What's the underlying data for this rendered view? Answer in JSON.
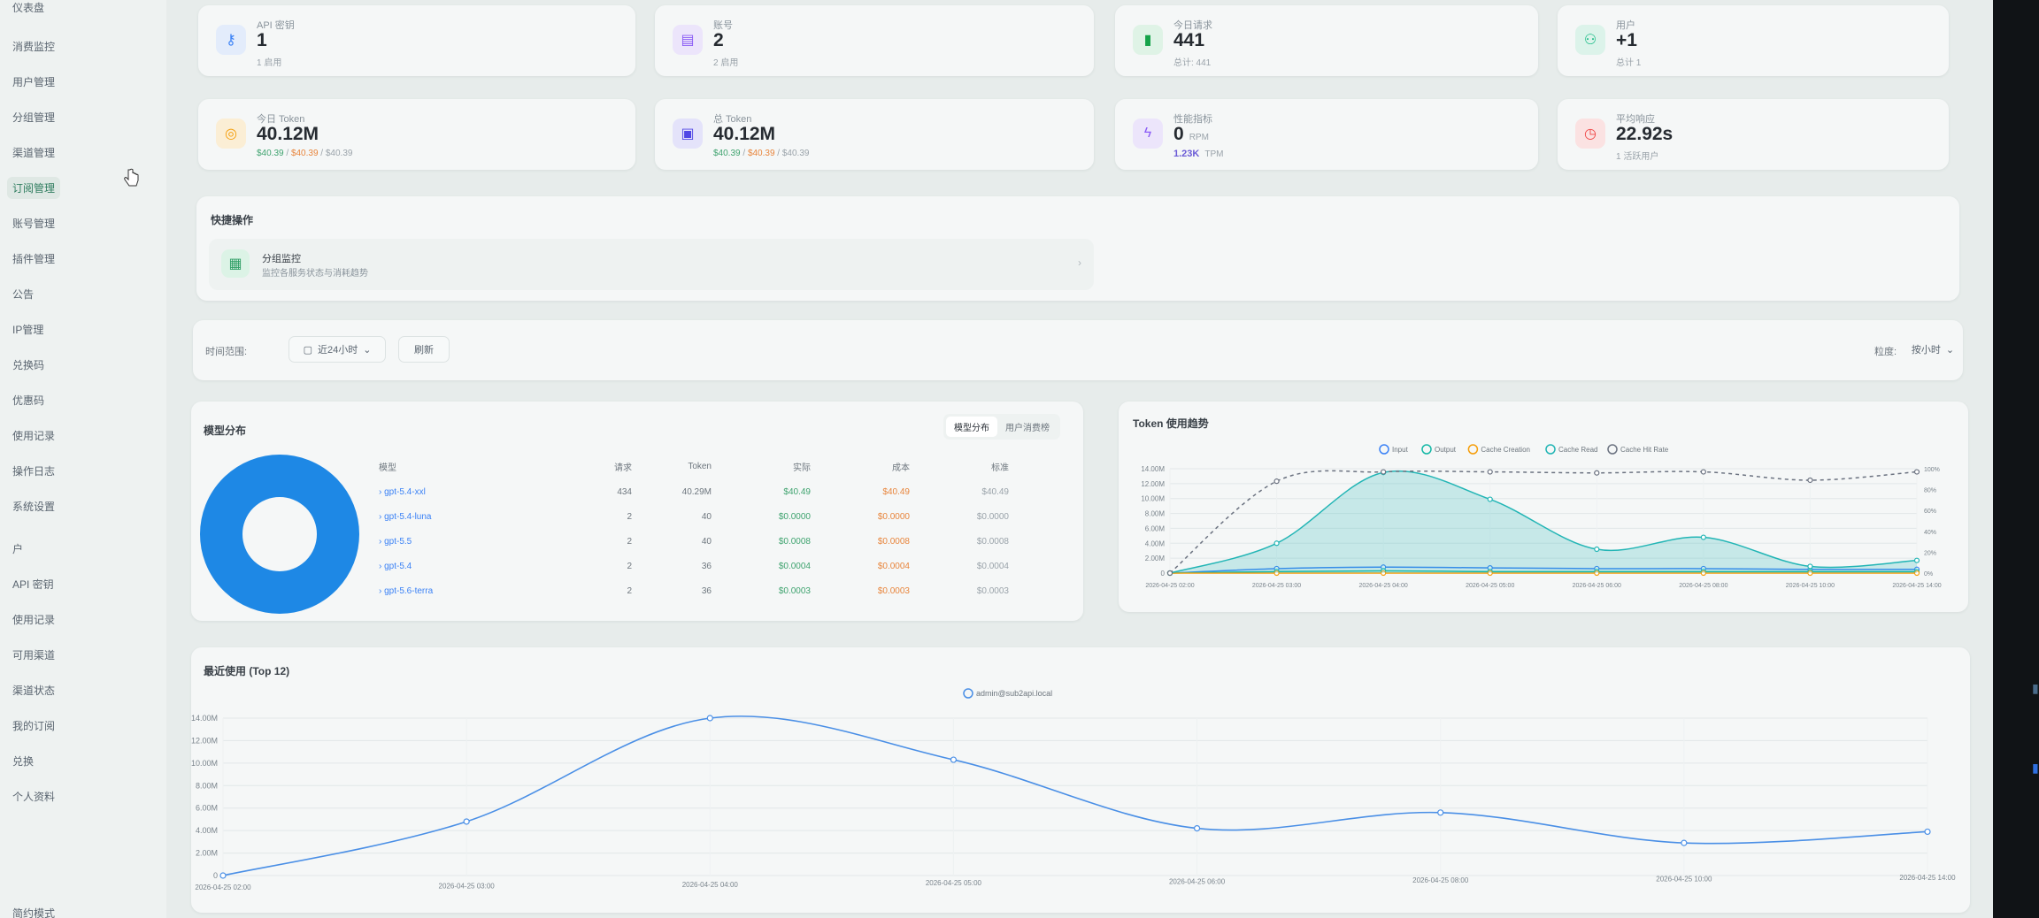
{
  "sidebar": {
    "items": [
      {
        "label": "仪表盘"
      },
      {
        "label": "消费监控"
      },
      {
        "label": "用户管理"
      },
      {
        "label": "分组管理"
      },
      {
        "label": "渠道管理"
      },
      {
        "label": "订阅管理"
      },
      {
        "label": "账号管理"
      },
      {
        "label": "插件管理"
      },
      {
        "label": "公告"
      },
      {
        "label": "IP管理"
      },
      {
        "label": "兑换码"
      },
      {
        "label": "优惠码"
      },
      {
        "label": "使用记录"
      },
      {
        "label": "操作日志"
      },
      {
        "label": "系统设置"
      },
      {
        "label": "户"
      },
      {
        "label": "API 密钥"
      },
      {
        "label": "使用记录"
      },
      {
        "label": "可用渠道"
      },
      {
        "label": "渠道状态"
      },
      {
        "label": "我的订阅"
      },
      {
        "label": "兑换"
      },
      {
        "label": "个人资料"
      },
      {
        "label": "简约模式"
      }
    ]
  },
  "stats_row1": [
    {
      "label": "API 密钥",
      "value": "1",
      "sub": "1 启用",
      "icon": "key-icon",
      "color": "#3b82f6",
      "bg": "#e3ecfb"
    },
    {
      "label": "账号",
      "value": "2",
      "sub": "2 启用",
      "icon": "server-icon",
      "color": "#8b5cf6",
      "bg": "#ece5fb"
    },
    {
      "label": "今日请求",
      "value": "441",
      "sub": "总计: 441",
      "icon": "bar-chart-icon",
      "color": "#16a34a",
      "bg": "#dff3e6"
    },
    {
      "label": "用户",
      "value": "+1",
      "sub": "总计 1",
      "icon": "users-icon",
      "color": "#10b981",
      "bg": "#dcf3ea"
    }
  ],
  "stats_row2": [
    {
      "label": "今日 Token",
      "value": "40.12M",
      "sub_parts": [
        "$40.39",
        " / ",
        "$40.39",
        " / ",
        "$40.39"
      ],
      "icon": "coin-icon",
      "color": "#f59e0b",
      "bg": "#fbeed5"
    },
    {
      "label": "总 Token",
      "value": "40.12M",
      "sub_parts": [
        "$40.39",
        " / ",
        "$40.39",
        " / ",
        "$40.39"
      ],
      "icon": "database-icon",
      "color": "#4f46e5",
      "bg": "#e4e3fa"
    },
    {
      "label": "性能指标",
      "value": "0",
      "value_unit": "RPM",
      "sub_strong": "1.23K",
      "sub_unit": "TPM",
      "icon": "bolt-icon",
      "color": "#8b5cf6",
      "bg": "#ece5fb"
    },
    {
      "label": "平均响应",
      "value": "22.92s",
      "sub": "1 活跃用户",
      "icon": "clock-icon",
      "color": "#ef4444",
      "bg": "#fbe2e2"
    }
  ],
  "quick_actions": {
    "title": "快捷操作",
    "item": {
      "title": "分组监控",
      "desc": "监控各服务状态与消耗趋势"
    }
  },
  "filters": {
    "time_label": "时间范围:",
    "time_value": "近24小时",
    "refresh": "刷新",
    "granularity_label": "粒度:",
    "granularity_value": "按小时"
  },
  "model_distribution": {
    "title": "模型分布",
    "tabs": [
      "模型分布",
      "用户消费榜"
    ],
    "headers": [
      "模型",
      "请求",
      "Token",
      "实际",
      "成本",
      "标准"
    ],
    "rows": [
      [
        "› gpt-5.4-xxl",
        "434",
        "40.29M",
        "$40.49",
        "$40.49",
        "$40.49"
      ],
      [
        "› gpt-5.4-luna",
        "2",
        "40",
        "$0.0000",
        "$0.0000",
        "$0.0000"
      ],
      [
        "› gpt-5.5",
        "2",
        "40",
        "$0.0008",
        "$0.0008",
        "$0.0008"
      ],
      [
        "› gpt-5.4",
        "2",
        "36",
        "$0.0004",
        "$0.0004",
        "$0.0004"
      ],
      [
        "› gpt-5.6-terra",
        "2",
        "36",
        "$0.0003",
        "$0.0003",
        "$0.0003"
      ]
    ]
  },
  "token_trend": {
    "title": "Token 使用趋势",
    "legend": [
      "Input",
      "Output",
      "Cache Creation",
      "Cache Read",
      "Cache Hit Rate"
    ]
  },
  "recent_usage": {
    "title": "最近使用 (Top 12)",
    "legend": [
      "admin@sub2api.local"
    ]
  },
  "chart_data": [
    {
      "type": "area",
      "title": "Token 使用趋势",
      "x": [
        "2026-04-25 02:00",
        "2026-04-25 03:00",
        "2026-04-25 04:00",
        "2026-04-25 05:00",
        "2026-04-25 06:00",
        "2026-04-25 08:00",
        "2026-04-25 10:00",
        "2026-04-25 14:00"
      ],
      "ylim": [
        0,
        14000000
      ],
      "yticks": [
        "14.00M",
        "12.00M",
        "10.00M",
        "8.00M",
        "6.00M",
        "4.00M",
        "2.00M",
        "0"
      ],
      "ylim_right": [
        0,
        100
      ],
      "yticks_right": [
        "100%",
        "80%",
        "60%",
        "40%",
        "20%",
        "0%"
      ],
      "series": [
        {
          "name": "Input",
          "color": "#3b82f6",
          "values": [
            0,
            600000,
            800000,
            700000,
            600000,
            600000,
            500000,
            500000
          ]
        },
        {
          "name": "Output",
          "color": "#14b8a6",
          "values": [
            0,
            200000,
            300000,
            200000,
            200000,
            200000,
            200000,
            200000
          ]
        },
        {
          "name": "Cache Creation",
          "color": "#f59e0b",
          "values": [
            0,
            0,
            0,
            0,
            0,
            0,
            0,
            0
          ]
        },
        {
          "name": "Cache Read",
          "color": "#22b5b5",
          "values": [
            0,
            4000000,
            13500000,
            9900000,
            3200000,
            4800000,
            900000,
            1700000
          ]
        },
        {
          "name": "Cache Hit Rate",
          "color": "#6b7280",
          "axis": "right",
          "values": [
            0,
            88,
            97,
            97,
            96,
            97,
            89,
            97
          ]
        }
      ]
    },
    {
      "type": "line",
      "title": "最近使用 (Top 12)",
      "x": [
        "2026-04-25 02:00",
        "2026-04-25 03:00",
        "2026-04-25 04:00",
        "2026-04-25 05:00",
        "2026-04-25 06:00",
        "2026-04-25 08:00",
        "2026-04-25 10:00",
        "2026-04-25 14:00"
      ],
      "ylim": [
        0,
        14000000
      ],
      "yticks": [
        "14.00M",
        "12.00M",
        "10.00M",
        "8.00M",
        "6.00M",
        "4.00M",
        "2.00M",
        "0"
      ],
      "series": [
        {
          "name": "admin@sub2api.local",
          "color": "#4a8fe6",
          "values": [
            0,
            4800000,
            14000000,
            10300000,
            4200000,
            5600000,
            2900000,
            3900000
          ]
        }
      ]
    }
  ]
}
